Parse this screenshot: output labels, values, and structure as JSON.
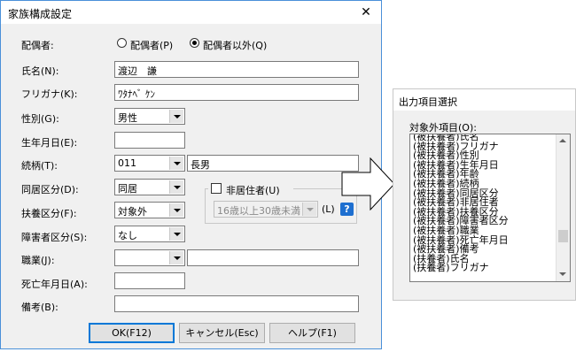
{
  "dialog": {
    "title": "家族構成設定",
    "close_glyph": "✕",
    "spouse": {
      "label": "配偶者:",
      "opt1": "配偶者(P)",
      "opt2": "配偶者以外(Q)",
      "selected": "配偶者以外(Q)"
    },
    "name": {
      "label": "氏名(N):",
      "value": "渡辺　謙"
    },
    "furigana": {
      "label": "フリガナ(K):",
      "value": "ﾜﾀﾅﾍﾞ ｹﾝ"
    },
    "gender": {
      "label": "性別(G):",
      "value": "男性"
    },
    "birth": {
      "label": "生年月日(E):",
      "value": ""
    },
    "relation": {
      "label": "続柄(T):",
      "code": "011",
      "text": "長男"
    },
    "cohabit": {
      "label": "同居区分(D):",
      "value": "同居"
    },
    "dependent": {
      "label": "扶養区分(F):",
      "value": "対象外"
    },
    "disability": {
      "label": "障害者区分(S):",
      "value": "なし"
    },
    "job": {
      "label": "職業(J):",
      "code": "",
      "text": ""
    },
    "death": {
      "label": "死亡年月日(A):",
      "value": ""
    },
    "note": {
      "label": "備考(B):",
      "value": ""
    },
    "nonresident": {
      "label": "非居住者(U)",
      "checked": false,
      "combo": "16歳以上30歳未満",
      "suffix": "(L)",
      "help_glyph": "?"
    },
    "buttons": {
      "ok": "OK(F12)",
      "cancel": "キャンセル(Esc)",
      "help": "ヘルプ(F1)"
    }
  },
  "side_panel": {
    "title": "出力項目選択",
    "list_label": "対象外項目(O):",
    "items": [
      "(被扶養者)氏名",
      "(被扶養者)フリガナ",
      "(被扶養者)性別",
      "(被扶養者)生年月日",
      "(被扶養者)年齢",
      "(被扶養者)続柄",
      "(被扶養者)同居区分",
      "(被扶養者)非居住者",
      "(被扶養者)扶養区分",
      "(被扶養者)障害者区分",
      "(被扶養者)職業",
      "(被扶養者)死亡年月日",
      "(被扶養者)備考",
      "(扶養者)氏名",
      "(扶養者)フリガナ"
    ]
  }
}
